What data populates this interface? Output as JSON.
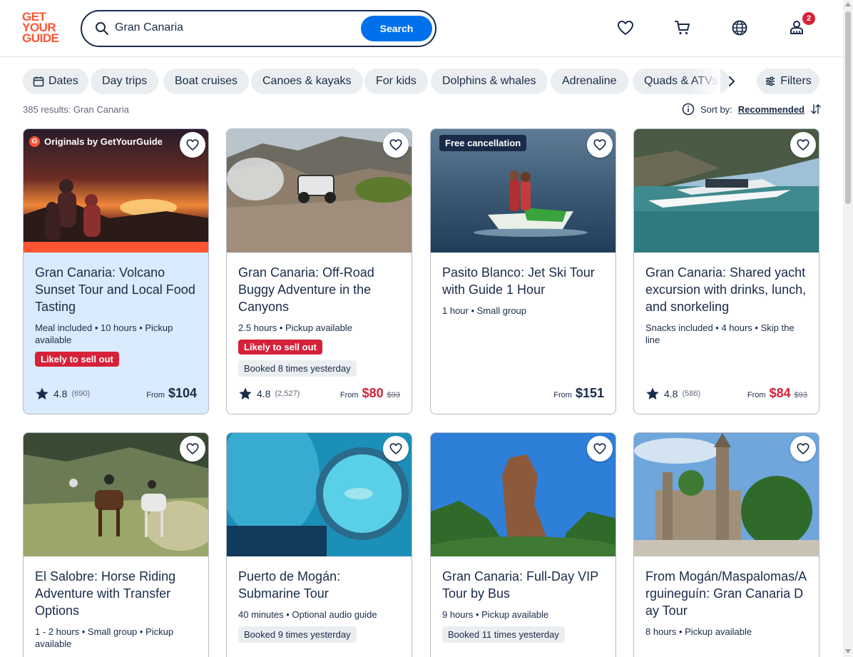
{
  "header": {
    "logo_lines": [
      "GET",
      "YOUR",
      "GUIDE"
    ],
    "search_value": "Gran Canaria",
    "search_button": "Search",
    "cart_badge": "2"
  },
  "chips": [
    "Dates",
    "Day trips",
    "Boat cruises",
    "Canoes & kayaks",
    "For kids",
    "Dolphins & whales",
    "Adrenaline",
    "Quads & ATVs"
  ],
  "filters_label": "Filters",
  "results_text": "385 results: Gran Canaria",
  "sort": {
    "label": "Sort by:",
    "value": "Recommended"
  },
  "cards": [
    {
      "title": "Gran Canaria: Volcano Sunset Tour and Local Food Tasting",
      "meta": "Meal included • 10 hours • Pickup available",
      "originals_label": "Originals by GetYourGuide",
      "badge_sell": "Likely to sell out",
      "rating": "4.8",
      "reviews": "(690)",
      "from": "From",
      "price": "$104"
    },
    {
      "title": "Gran Canaria: Off-Road Buggy Adventure in the Canyons",
      "meta": "2.5 hours • Pickup available",
      "badge_sell": "Likely to sell out",
      "booked": "Booked 8 times yesterday",
      "rating": "4.8",
      "reviews": "(2,527)",
      "from": "From",
      "price": "$80",
      "old_price": "$93"
    },
    {
      "title": "Pasito Blanco: Jet Ski Tour with Guide 1 Hour",
      "meta": "1 hour • Small group",
      "tag": "Free cancellation",
      "from": "From",
      "price": "$151"
    },
    {
      "title": "Gran Canaria: Shared yacht excursion with drinks, lunch, and snorkeling",
      "meta": "Snacks included • 4 hours • Skip the line",
      "rating": "4.8",
      "reviews": "(586)",
      "from": "From",
      "price": "$84",
      "old_price": "$93"
    },
    {
      "title": "El Salobre: Horse Riding Adventure with Transfer Options",
      "meta": "1 - 2 hours • Small group • Pickup available"
    },
    {
      "title": "Puerto de Mogán: Submarine Tour",
      "meta": "40 minutes • Optional audio guide",
      "booked": "Booked 9 times yesterday"
    },
    {
      "title": "Gran Canaria: Full-Day VIP Tour by Bus",
      "meta": "9 hours • Pickup available",
      "booked": "Booked 11 times yesterday"
    },
    {
      "title": "From Mogán/Maspalomas/Arguineguín: Gran Canaria Day Tour",
      "meta": "8 hours • Pickup available"
    }
  ],
  "colors": {
    "brand": "#ff5533",
    "primary": "#0071eb",
    "sale": "#d6213a",
    "navy": "#1a2b49"
  },
  "icons": [
    "search-icon",
    "heart-icon",
    "cart-icon",
    "globe-icon",
    "profile-icon",
    "calendar-icon",
    "chevron-right-icon",
    "filters-icon",
    "info-icon",
    "sort-icon",
    "star-icon"
  ]
}
